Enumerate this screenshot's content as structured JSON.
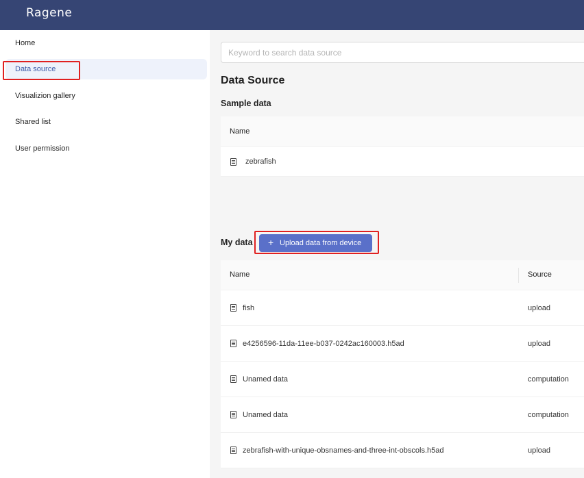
{
  "app": {
    "logo": "Ragene"
  },
  "sidebar": {
    "items": [
      {
        "label": "Home"
      },
      {
        "label": "Data source"
      },
      {
        "label": "Visualizion gallery"
      },
      {
        "label": "Shared list"
      },
      {
        "label": "User permission"
      }
    ]
  },
  "search": {
    "placeholder": "Keyword to search data source"
  },
  "page": {
    "title": "Data Source"
  },
  "sample": {
    "title": "Sample data",
    "header_name": "Name",
    "rows": [
      {
        "name": "zebrafish"
      }
    ]
  },
  "mydata": {
    "title": "My data",
    "upload_label": "Upload data from device",
    "header_name": "Name",
    "header_source": "Source",
    "rows": [
      {
        "name": "fish",
        "source": "upload"
      },
      {
        "name": "e4256596-11da-11ee-b037-0242ac160003.h5ad",
        "source": "upload"
      },
      {
        "name": "Unamed data",
        "source": "computation"
      },
      {
        "name": "Unamed data",
        "source": "computation"
      },
      {
        "name": "zebrafish-with-unique-obsnames-and-three-int-obscols.h5ad",
        "source": "upload"
      }
    ]
  },
  "colors": {
    "topbar": "#364574",
    "accent": "#5a70c9",
    "highlight": "#e02020"
  }
}
